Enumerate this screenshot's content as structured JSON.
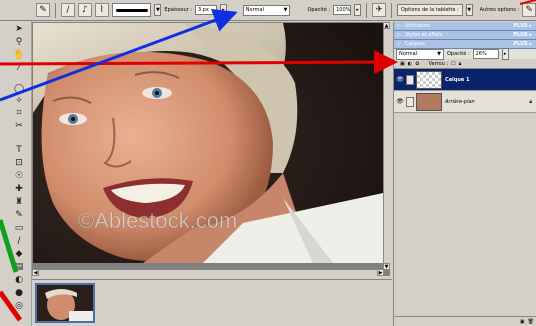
{
  "options_bar": {
    "epaisseur_label": "Epaisseur :",
    "epaisseur_value": "3 px",
    "mode_value": "Normal",
    "opacite_label": "Opacité :",
    "opacite_value": "100%",
    "tablet_options": "Options de la tablette :",
    "other_options": "Autres options :"
  },
  "palettes": [
    {
      "name": "Utilisation",
      "action": "PLUS"
    },
    {
      "name": "Styles et effets",
      "action": "PLUS"
    },
    {
      "name": "Calques",
      "action": "PLUS"
    }
  ],
  "layers_panel": {
    "blend_mode": "Normal",
    "opacity_label": "Opacité :",
    "opacity_value": "26%",
    "lock_label": "Verrou :"
  },
  "layers": [
    {
      "name": "Calque 1",
      "selected": true
    },
    {
      "name": "Arrière-plan",
      "selected": false
    }
  ],
  "photo": {
    "watermark": "©Ablestock.com"
  },
  "colors": {
    "arrow_red": "#e00000",
    "arrow_blue": "#1030e0",
    "arrow_green": "#10a020",
    "selected_layer": "#0a246a",
    "palette_tab": "#a9c2e6"
  }
}
